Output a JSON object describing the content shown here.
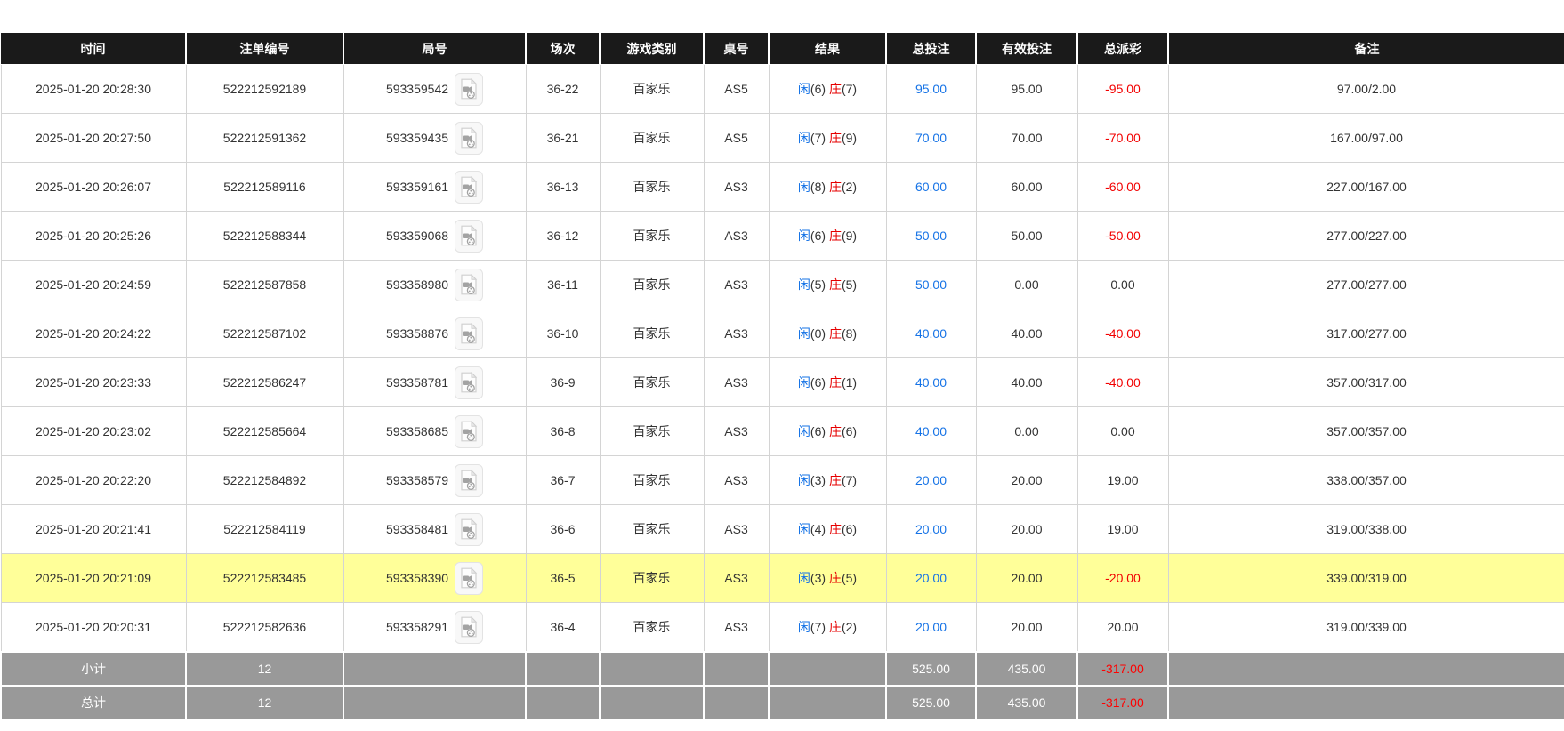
{
  "table": {
    "columns": [
      {
        "key": "time",
        "label": "时间"
      },
      {
        "key": "bet-id",
        "label": "注单编号"
      },
      {
        "key": "round",
        "label": "局号"
      },
      {
        "key": "session",
        "label": "场次"
      },
      {
        "key": "game-type",
        "label": "游戏类别"
      },
      {
        "key": "table-no",
        "label": "桌号"
      },
      {
        "key": "result",
        "label": "结果"
      },
      {
        "key": "total-bet",
        "label": "总投注"
      },
      {
        "key": "valid-bet",
        "label": "有效投注"
      },
      {
        "key": "payout",
        "label": "总派彩"
      },
      {
        "key": "remark",
        "label": "备注"
      }
    ],
    "rows": [
      {
        "time": "2025-01-20 20:28:30",
        "bet_id": "522212592189",
        "round_id": "593359542",
        "session": "36-22",
        "game_type": "百家乐",
        "table_no": "AS5",
        "result": {
          "player": "闲",
          "player_score": "(6)",
          "banker": "庄",
          "banker_score": "(7)"
        },
        "total_bet": "95.00",
        "valid_bet": "95.00",
        "payout": "-95.00",
        "remark": "97.00/2.00",
        "highlighted": false
      },
      {
        "time": "2025-01-20 20:27:50",
        "bet_id": "522212591362",
        "round_id": "593359435",
        "session": "36-21",
        "game_type": "百家乐",
        "table_no": "AS5",
        "result": {
          "player": "闲",
          "player_score": "(7)",
          "banker": "庄",
          "banker_score": "(9)"
        },
        "total_bet": "70.00",
        "valid_bet": "70.00",
        "payout": "-70.00",
        "remark": "167.00/97.00",
        "highlighted": false
      },
      {
        "time": "2025-01-20 20:26:07",
        "bet_id": "522212589116",
        "round_id": "593359161",
        "session": "36-13",
        "game_type": "百家乐",
        "table_no": "AS3",
        "result": {
          "player": "闲",
          "player_score": "(8)",
          "banker": "庄",
          "banker_score": "(2)"
        },
        "total_bet": "60.00",
        "valid_bet": "60.00",
        "payout": "-60.00",
        "remark": "227.00/167.00",
        "highlighted": false
      },
      {
        "time": "2025-01-20 20:25:26",
        "bet_id": "522212588344",
        "round_id": "593359068",
        "session": "36-12",
        "game_type": "百家乐",
        "table_no": "AS3",
        "result": {
          "player": "闲",
          "player_score": "(6)",
          "banker": "庄",
          "banker_score": "(9)"
        },
        "total_bet": "50.00",
        "valid_bet": "50.00",
        "payout": "-50.00",
        "remark": "277.00/227.00",
        "highlighted": false
      },
      {
        "time": "2025-01-20 20:24:59",
        "bet_id": "522212587858",
        "round_id": "593358980",
        "session": "36-11",
        "game_type": "百家乐",
        "table_no": "AS3",
        "result": {
          "player": "闲",
          "player_score": "(5)",
          "banker": "庄",
          "banker_score": "(5)"
        },
        "total_bet": "50.00",
        "valid_bet": "0.00",
        "payout": "0.00",
        "remark": "277.00/277.00",
        "highlighted": false
      },
      {
        "time": "2025-01-20 20:24:22",
        "bet_id": "522212587102",
        "round_id": "593358876",
        "session": "36-10",
        "game_type": "百家乐",
        "table_no": "AS3",
        "result": {
          "player": "闲",
          "player_score": "(0)",
          "banker": "庄",
          "banker_score": "(8)"
        },
        "total_bet": "40.00",
        "valid_bet": "40.00",
        "payout": "-40.00",
        "remark": "317.00/277.00",
        "highlighted": false
      },
      {
        "time": "2025-01-20 20:23:33",
        "bet_id": "522212586247",
        "round_id": "593358781",
        "session": "36-9",
        "game_type": "百家乐",
        "table_no": "AS3",
        "result": {
          "player": "闲",
          "player_score": "(6)",
          "banker": "庄",
          "banker_score": "(1)"
        },
        "total_bet": "40.00",
        "valid_bet": "40.00",
        "payout": "-40.00",
        "remark": "357.00/317.00",
        "highlighted": false
      },
      {
        "time": "2025-01-20 20:23:02",
        "bet_id": "522212585664",
        "round_id": "593358685",
        "session": "36-8",
        "game_type": "百家乐",
        "table_no": "AS3",
        "result": {
          "player": "闲",
          "player_score": "(6)",
          "banker": "庄",
          "banker_score": "(6)"
        },
        "total_bet": "40.00",
        "valid_bet": "0.00",
        "payout": "0.00",
        "remark": "357.00/357.00",
        "highlighted": false
      },
      {
        "time": "2025-01-20 20:22:20",
        "bet_id": "522212584892",
        "round_id": "593358579",
        "session": "36-7",
        "game_type": "百家乐",
        "table_no": "AS3",
        "result": {
          "player": "闲",
          "player_score": "(3)",
          "banker": "庄",
          "banker_score": "(7)"
        },
        "total_bet": "20.00",
        "valid_bet": "20.00",
        "payout": "19.00",
        "remark": "338.00/357.00",
        "highlighted": false
      },
      {
        "time": "2025-01-20 20:21:41",
        "bet_id": "522212584119",
        "round_id": "593358481",
        "session": "36-6",
        "game_type": "百家乐",
        "table_no": "AS3",
        "result": {
          "player": "闲",
          "player_score": "(4)",
          "banker": "庄",
          "banker_score": "(6)"
        },
        "total_bet": "20.00",
        "valid_bet": "20.00",
        "payout": "19.00",
        "remark": "319.00/338.00",
        "highlighted": false
      },
      {
        "time": "2025-01-20 20:21:09",
        "bet_id": "522212583485",
        "round_id": "593358390",
        "session": "36-5",
        "game_type": "百家乐",
        "table_no": "AS3",
        "result": {
          "player": "闲",
          "player_score": "(3)",
          "banker": "庄",
          "banker_score": "(5)"
        },
        "total_bet": "20.00",
        "valid_bet": "20.00",
        "payout": "-20.00",
        "remark": "339.00/319.00",
        "highlighted": true
      },
      {
        "time": "2025-01-20 20:20:31",
        "bet_id": "522212582636",
        "round_id": "593358291",
        "session": "36-4",
        "game_type": "百家乐",
        "table_no": "AS3",
        "result": {
          "player": "闲",
          "player_score": "(7)",
          "banker": "庄",
          "banker_score": "(2)"
        },
        "total_bet": "20.00",
        "valid_bet": "20.00",
        "payout": "20.00",
        "remark": "319.00/339.00",
        "highlighted": false
      }
    ],
    "summary_rows": [
      {
        "label": "小计",
        "count": "12",
        "total_bet": "525.00",
        "valid_bet": "435.00",
        "payout": "-317.00"
      },
      {
        "label": "总计",
        "count": "12",
        "total_bet": "525.00",
        "valid_bet": "435.00",
        "payout": "-317.00"
      }
    ]
  },
  "icons": {
    "video_replay": "video-replay-icon"
  },
  "colors": {
    "header_bg": "#1a1a1a",
    "player_blue": "#1673e6",
    "banker_red": "#e60000",
    "negative_red": "#f20000",
    "summary_bg": "#999999",
    "highlight_yellow": "#ffff99"
  }
}
